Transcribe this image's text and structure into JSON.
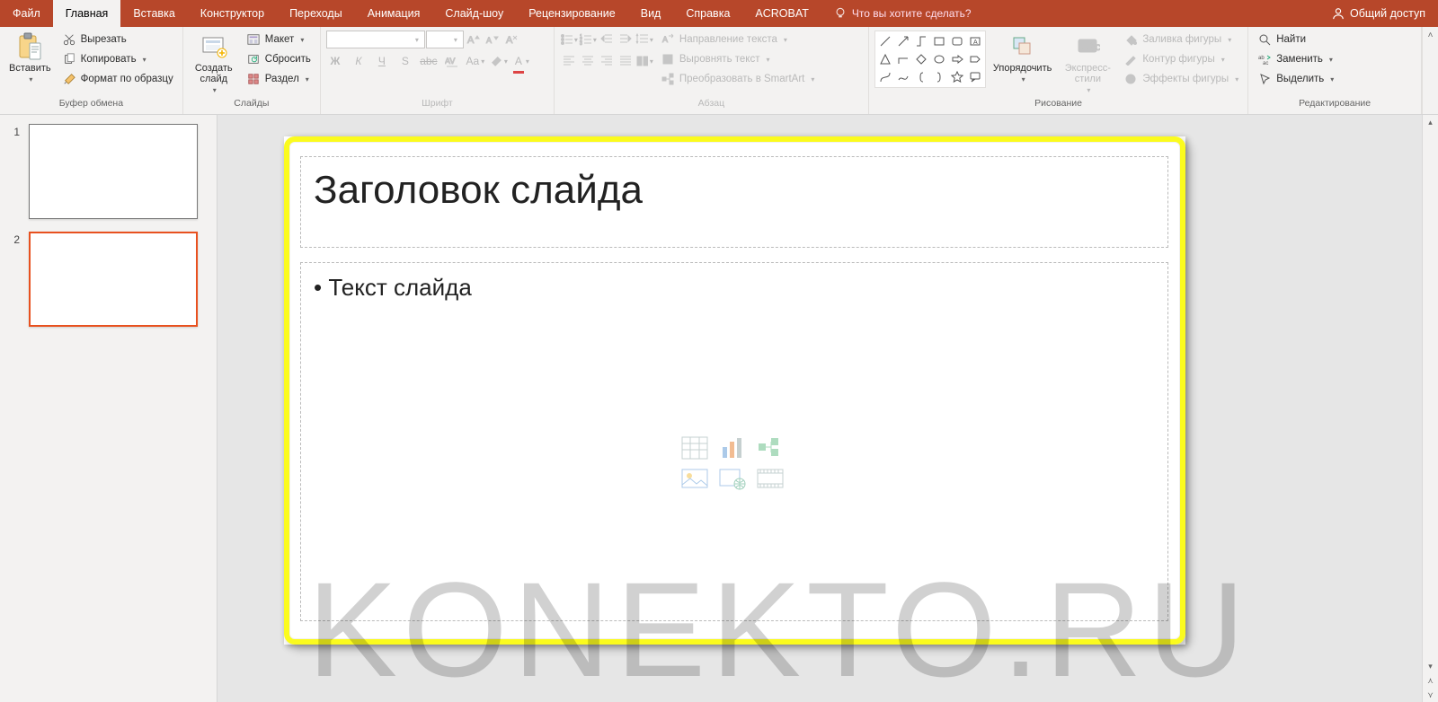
{
  "colors": {
    "brand": "#b7472a",
    "accent": "#e8511f",
    "highlight": "#fbfb1e"
  },
  "tabs": {
    "file": "Файл",
    "items": [
      "Главная",
      "Вставка",
      "Конструктор",
      "Переходы",
      "Анимация",
      "Слайд-шоу",
      "Рецензирование",
      "Вид",
      "Справка",
      "ACROBAT"
    ],
    "active_index": 0,
    "tellme": "Что вы хотите сделать?",
    "share": "Общий доступ"
  },
  "ribbon": {
    "clipboard": {
      "label": "Буфер обмена",
      "paste": "Вставить",
      "cut": "Вырезать",
      "copy": "Копировать",
      "format_painter": "Формат по образцу"
    },
    "slides": {
      "label": "Слайды",
      "new_slide": "Создать слайд",
      "layout": "Макет",
      "reset": "Сбросить",
      "section": "Раздел"
    },
    "font": {
      "label": "Шрифт"
    },
    "paragraph": {
      "label": "Абзац",
      "text_direction": "Направление текста",
      "align_text": "Выровнять текст",
      "smartart": "Преобразовать в SmartArt"
    },
    "drawing": {
      "label": "Рисование",
      "arrange": "Упорядочить",
      "quick_styles": "Экспресс-стили",
      "shape_fill": "Заливка фигуры",
      "shape_outline": "Контур фигуры",
      "shape_effects": "Эффекты фигуры"
    },
    "editing": {
      "label": "Редактирование",
      "find": "Найти",
      "replace": "Заменить",
      "select": "Выделить"
    }
  },
  "thumbnails": [
    {
      "number": "1",
      "selected": false
    },
    {
      "number": "2",
      "selected": true
    }
  ],
  "slide": {
    "title": "Заголовок слайда",
    "body": "Текст слайда"
  },
  "watermark": "KONEKTO.RU"
}
